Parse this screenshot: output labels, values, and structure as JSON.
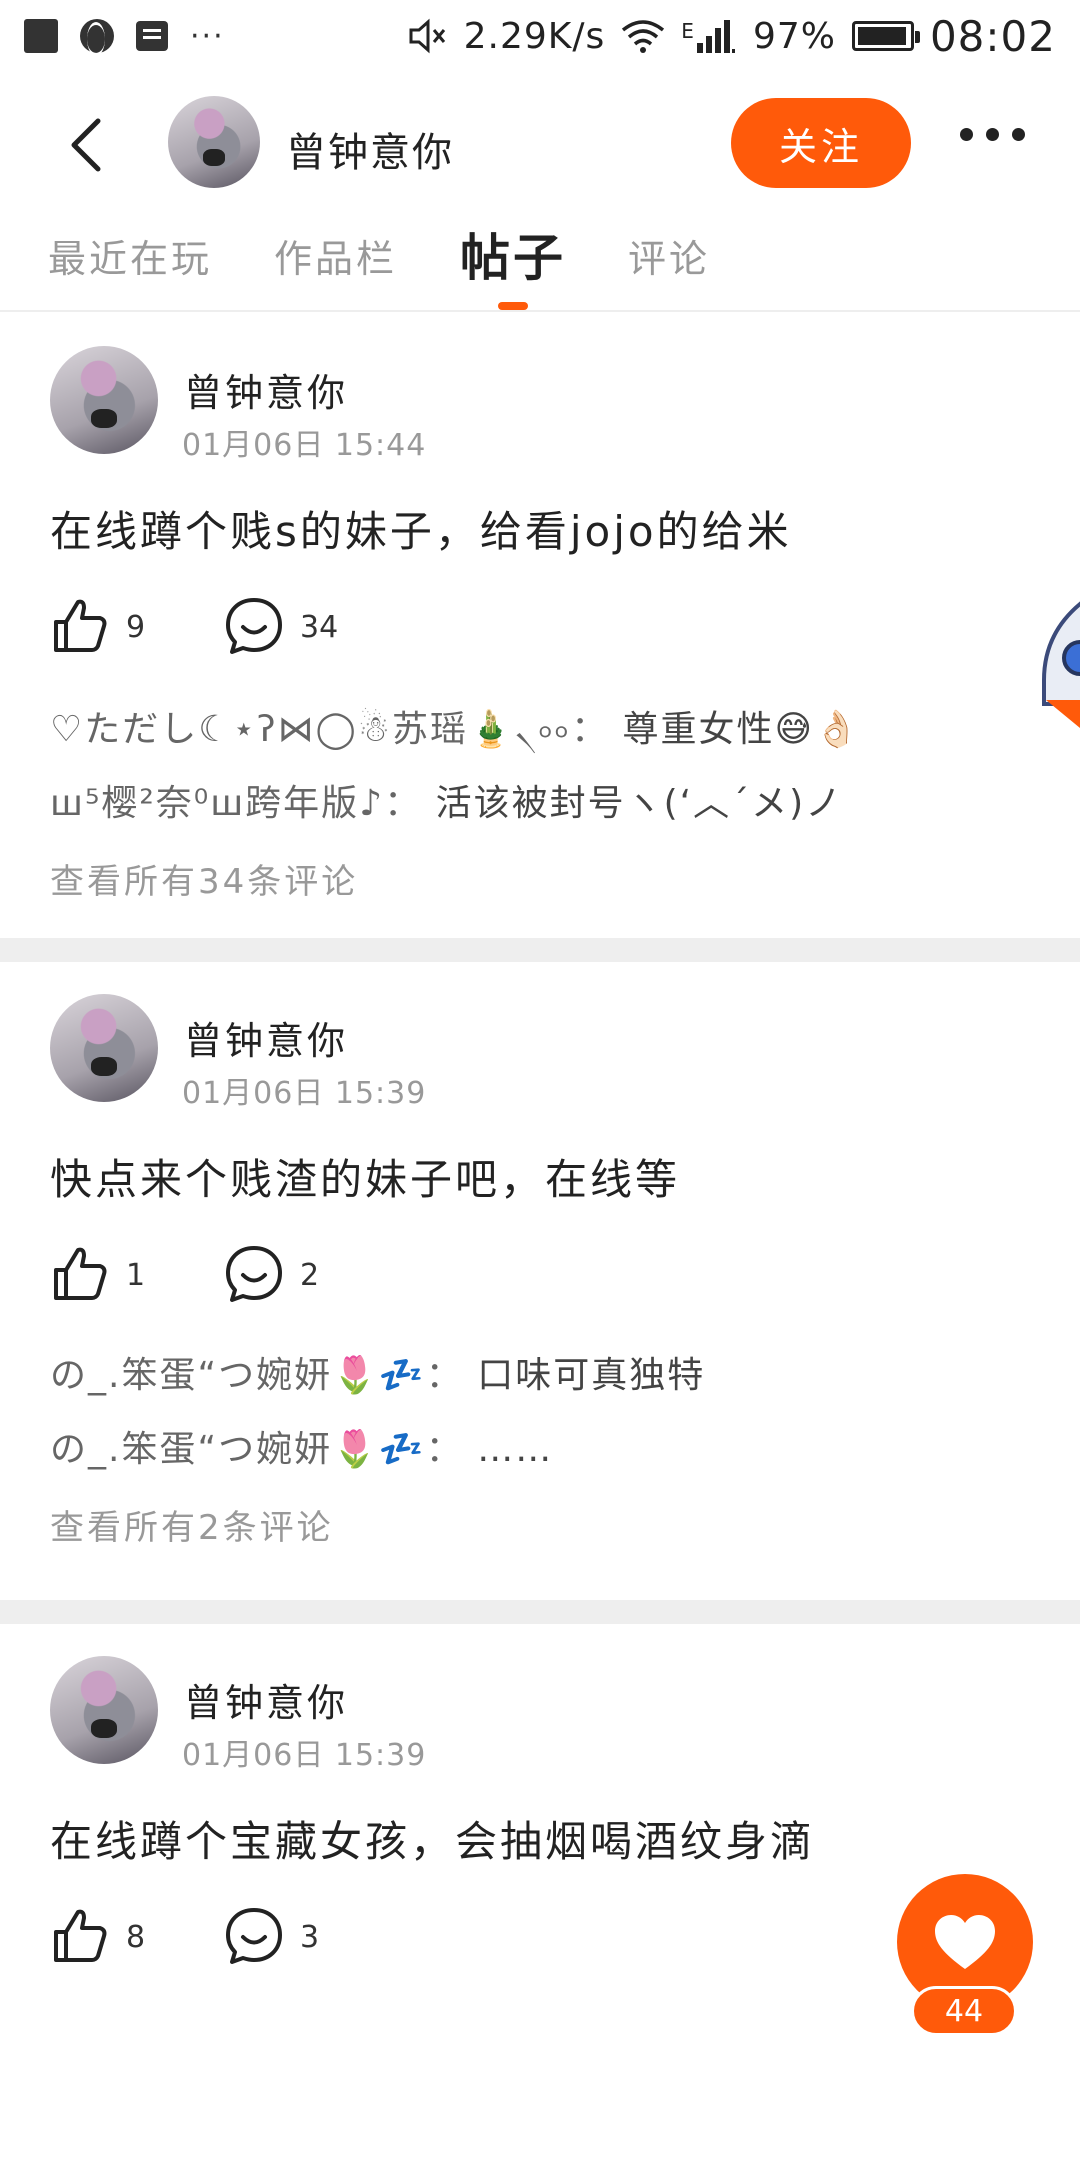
{
  "status_bar": {
    "net_speed": "2.29K/s",
    "network_type": "E",
    "battery": "97%",
    "battery_level": 0.97,
    "time": "08:02",
    "icons": [
      "notification-square-icon",
      "globe-icon",
      "message-icon",
      "more-notifications-icon",
      "mute-icon",
      "wifi-icon",
      "signal-icon",
      "battery-icon"
    ],
    "overflow": "···"
  },
  "header": {
    "username": "曾钟意你",
    "follow_label": "关注"
  },
  "tabs": [
    {
      "label": "最近在玩",
      "active": false
    },
    {
      "label": "作品栏",
      "active": false
    },
    {
      "label": "帖子",
      "active": true
    },
    {
      "label": "评论",
      "active": false
    }
  ],
  "posts": [
    {
      "author": "曾钟意你",
      "time": "01月06日  15:44",
      "text": "在线蹲个贱s的妹子，给看jojo的给米",
      "likes": "9",
      "comments_count": "34",
      "comments": [
        {
          "name": "♡ただし☾⋆ʔ⋈◯☃苏瑶🎍৲৹৹：",
          "text": "尊重女性😅👌🏻"
        },
        {
          "name": "ꟺ⁵樱²奈⁰ꟺ跨年版♪：",
          "text": "活该被封号ヽ(‘︿´メ)ノ"
        }
      ],
      "view_all": "查看所有34条评论"
    },
    {
      "author": "曾钟意你",
      "time": "01月06日  15:39",
      "text": "快点来个贱渣的妹子吧，在线等",
      "likes": "1",
      "comments_count": "2",
      "comments": [
        {
          "name": "の_.笨蛋“つ婉妍🌷💤：",
          "text": "口味可真独特"
        },
        {
          "name": "の_.笨蛋“つ婉妍🌷💤：",
          "text": "……"
        }
      ],
      "view_all": "查看所有2条评论"
    },
    {
      "author": "曾钟意你",
      "time": "01月06日  15:39",
      "text": "在线蹲个宝藏女孩，会抽烟喝酒纹身滴",
      "likes": "8",
      "comments_count": "3"
    }
  ],
  "fab": {
    "like_count": "44",
    "icon": "heart-icon"
  },
  "colors": {
    "accent": "#ff5a0a",
    "divider": "#eeeeee",
    "muted_text": "#999999"
  }
}
